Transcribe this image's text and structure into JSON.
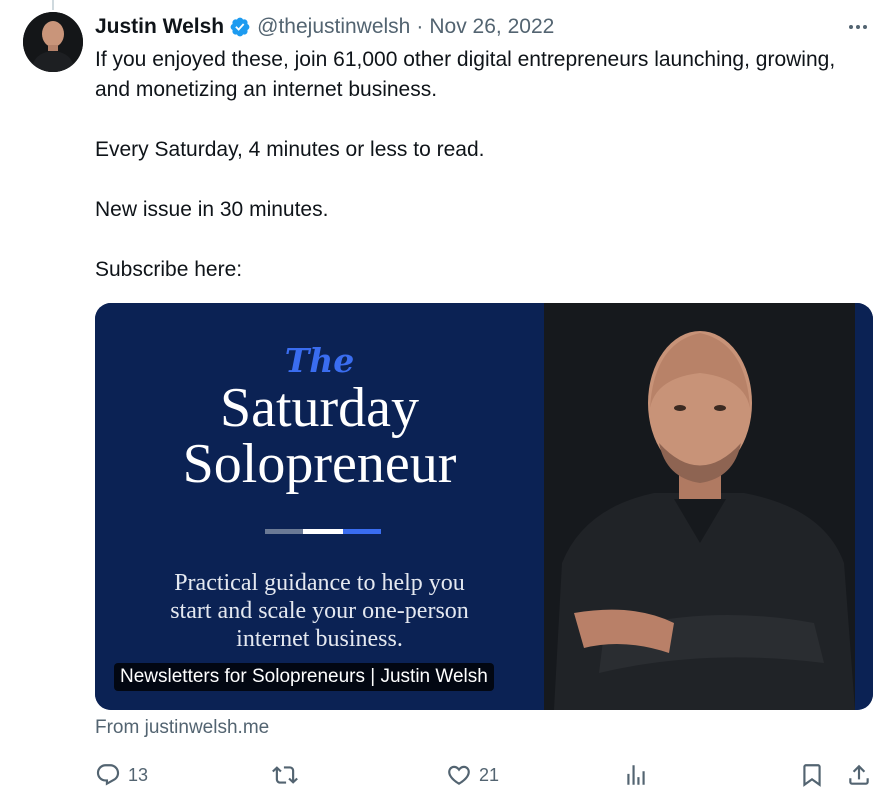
{
  "tweet": {
    "author_name": "Justin Welsh",
    "handle": "@thejustinwelsh",
    "separator": "·",
    "date": "Nov 26, 2022",
    "verified": true,
    "paragraphs": [
      "If you enjoyed these, join 61,000 other digital entrepreneurs launching, growing, and monetizing an internet business.",
      "Every Saturday, 4 minutes or less to read.",
      "New issue in 30 minutes.",
      "Subscribe here:"
    ]
  },
  "card": {
    "title_prefix": "The",
    "title_line1": "Saturday",
    "title_line2": "Solopreneur",
    "tagline_lines": [
      "Practical guidance to help you",
      "start and scale your one-person",
      "internet business."
    ],
    "label": "Newsletters for Solopreneurs | Justin Welsh",
    "source": "From justinwelsh.me"
  },
  "actions": {
    "replies": "13",
    "retweets": "",
    "likes": "21",
    "views": ""
  },
  "colors": {
    "verified_badge": "#1d9bf0",
    "card_background": "#0b2254",
    "title_accent": "#3a6df0",
    "muted_text": "#536471"
  },
  "icons": [
    "more-icon",
    "reply-icon",
    "retweet-icon",
    "like-icon",
    "views-icon",
    "bookmark-icon",
    "share-icon"
  ]
}
